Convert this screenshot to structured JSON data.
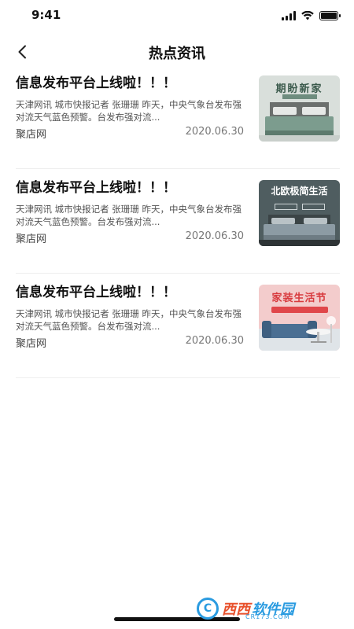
{
  "status": {
    "time": "9:41"
  },
  "nav": {
    "title": "热点资讯",
    "back_icon": "chevron-left-icon"
  },
  "news": [
    {
      "title": "信息发布平台上线啦！！！",
      "summary": "天津网讯 城市快报记者 张珊珊 昨天，中央气象台发布强对流天气蓝色预警。台发布强对流...",
      "source": "聚店网",
      "date": "2020.06.30",
      "thumb": {
        "caption": "期盼新家",
        "bg": "#d8dcd8",
        "accent": "#6e8c7e"
      }
    },
    {
      "title": "信息发布平台上线啦！！！",
      "summary": "天津网讯 城市快报记者 张珊珊 昨天，中央气象台发布强对流天气蓝色预警。台发布强对流...",
      "source": "聚店网",
      "date": "2020.06.30",
      "thumb": {
        "caption": "北欧极简生活",
        "bg": "#4e5c5e",
        "accent": "#8a9aa4"
      }
    },
    {
      "title": "信息发布平台上线啦！！！",
      "summary": "天津网讯 城市快报记者 张珊珊 昨天，中央气象台发布强对流天气蓝色预警。台发布强对流...",
      "source": "聚店网",
      "date": "2020.06.30",
      "thumb": {
        "caption": "家装生活节",
        "bg": "#f2c9c9",
        "accent": "#e0464a"
      }
    }
  ],
  "watermark": {
    "letter": "C",
    "name": "西西",
    "name2": "软件园",
    "sub": "CR173.COM"
  }
}
